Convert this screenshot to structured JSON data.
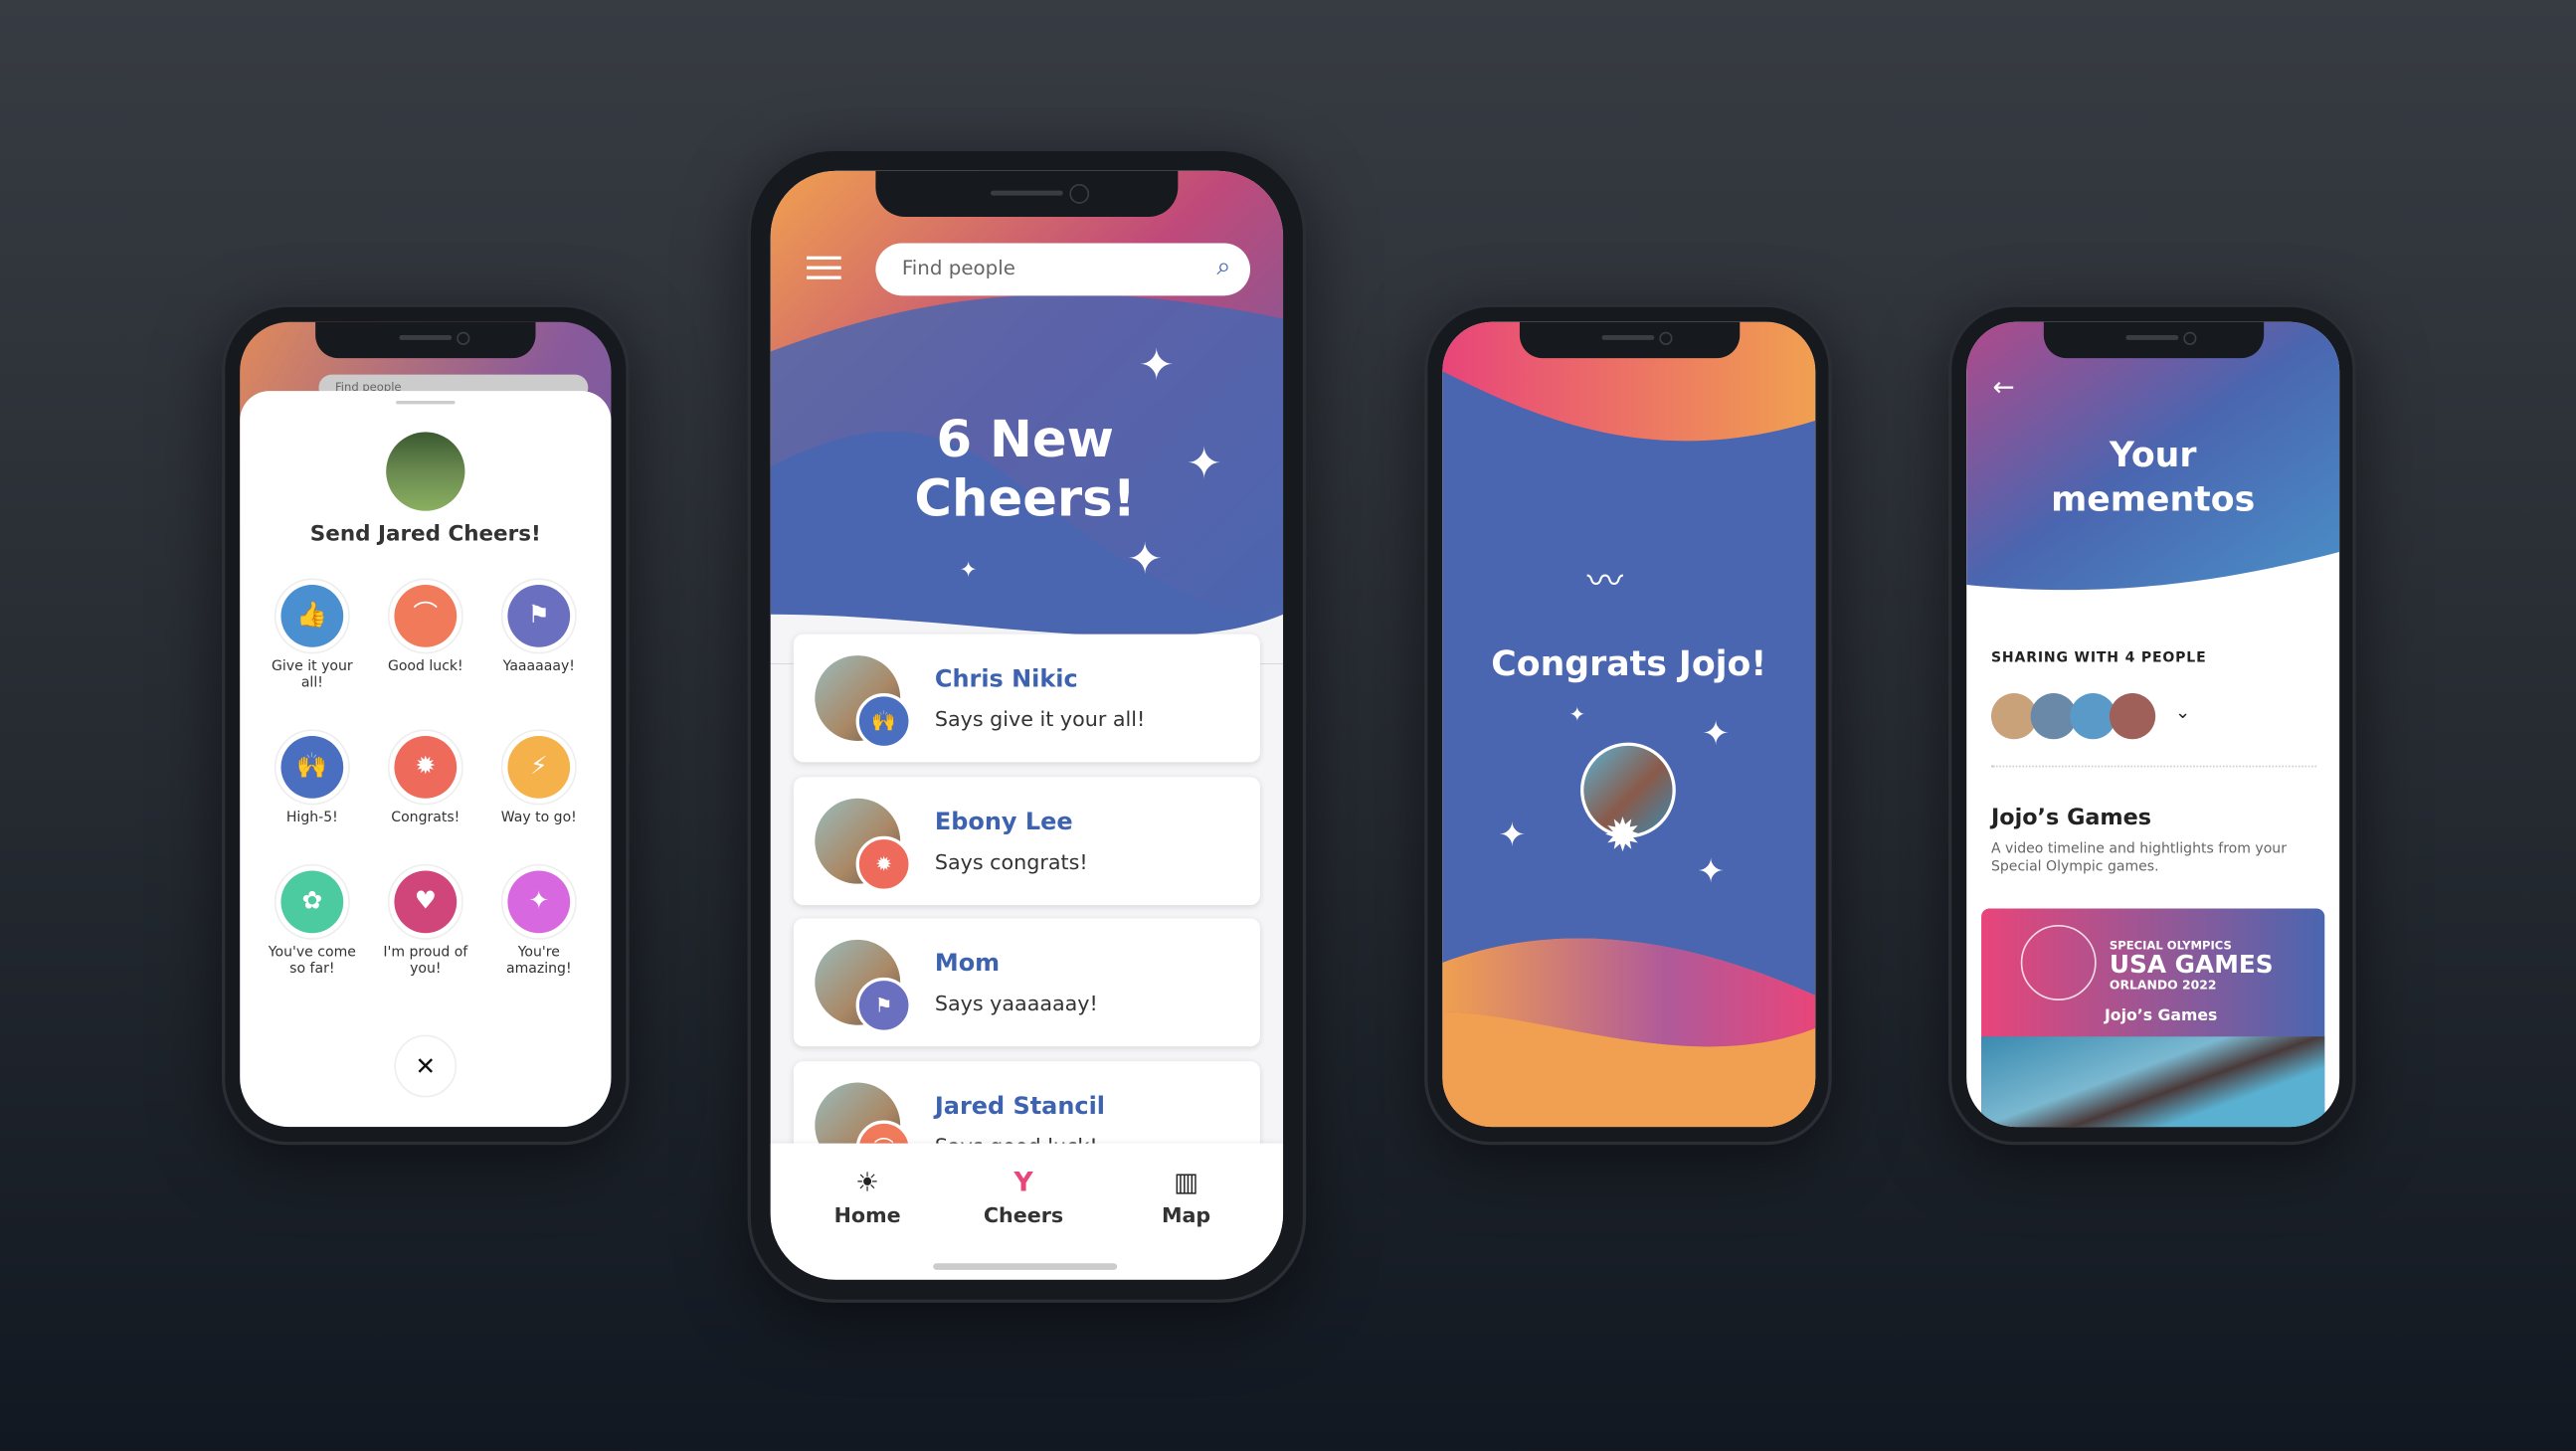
{
  "phone1": {
    "search_placeholder": "Find people",
    "title": "Send Jared Cheers!",
    "close_icon": "close-icon",
    "cheers": [
      {
        "label": "Give it your all!",
        "icon": "thumbs-up-icon",
        "glyph": "👍",
        "color": "#4a8fcf"
      },
      {
        "label": "Good luck!",
        "icon": "rainbow-icon",
        "glyph": "⌒",
        "color": "#f07a5a"
      },
      {
        "label": "Yaaaaaay!",
        "icon": "flag-icon",
        "glyph": "⚑",
        "color": "#6a6fc0"
      },
      {
        "label": "High-5!",
        "icon": "high-five-icon",
        "glyph": "🙌",
        "color": "#4a6fc0"
      },
      {
        "label": "Congrats!",
        "icon": "award-icon",
        "glyph": "✹",
        "color": "#ee6a5a"
      },
      {
        "label": "Way to go!",
        "icon": "lightning-icon",
        "glyph": "⚡",
        "color": "#f5b24a"
      },
      {
        "label": "You've come so far!",
        "icon": "flower-icon",
        "glyph": "✿",
        "color": "#4ccaa0"
      },
      {
        "label": "I'm proud of you!",
        "icon": "heart-icon",
        "glyph": "♥",
        "color": "#d0457a"
      },
      {
        "label": "You're amazing!",
        "icon": "sparkles-icon",
        "glyph": "✦",
        "color": "#d868e0"
      }
    ]
  },
  "phone2": {
    "search_placeholder": "Find people",
    "headline_1": "6 New",
    "headline_2": "Cheers!",
    "cards": [
      {
        "name": "Chris Nikic",
        "message": "Says give it your all!",
        "badge_icon": "high-five-icon",
        "glyph": "🙌",
        "color": "#4a6fc0"
      },
      {
        "name": "Ebony Lee",
        "message": "Says congrats!",
        "badge_icon": "award-icon",
        "glyph": "✹",
        "color": "#ee6a5a"
      },
      {
        "name": "Mom",
        "message": "Says yaaaaaay!",
        "badge_icon": "flag-icon",
        "glyph": "⚑",
        "color": "#6a6fc0"
      },
      {
        "name": "Jared Stancil",
        "message": "Says good luck!",
        "badge_icon": "rainbow-icon",
        "glyph": "⌒",
        "color": "#f07a5a"
      }
    ],
    "nav": [
      {
        "label": "Home",
        "icon": "sun-icon",
        "glyph": "☀"
      },
      {
        "label": "Cheers",
        "icon": "cheers-icon",
        "glyph": "Y",
        "active": true
      },
      {
        "label": "Map",
        "icon": "map-icon",
        "glyph": "▥"
      }
    ],
    "accent": "#e8457a"
  },
  "phone3": {
    "title": "Congrats Jojo!",
    "icon": "swimmer-icon"
  },
  "phone4": {
    "title_1": "Your",
    "title_2": "mementos",
    "sharing": "SHARING WITH 4 PEOPLE",
    "section_title": "Jojo’s Games",
    "section_desc": "A video timeline and hightlights from your Special Olympic games.",
    "banner": {
      "line1": "SPECIAL OLYMPICS",
      "line2": "USA GAMES",
      "line3": "ORLANDO 2022",
      "line4": "Jojo’s Games"
    }
  },
  "colors": {
    "blue": "#4a66b0",
    "pink": "#e8457a",
    "orange": "#f0a050",
    "purple": "#8a4f9a"
  }
}
